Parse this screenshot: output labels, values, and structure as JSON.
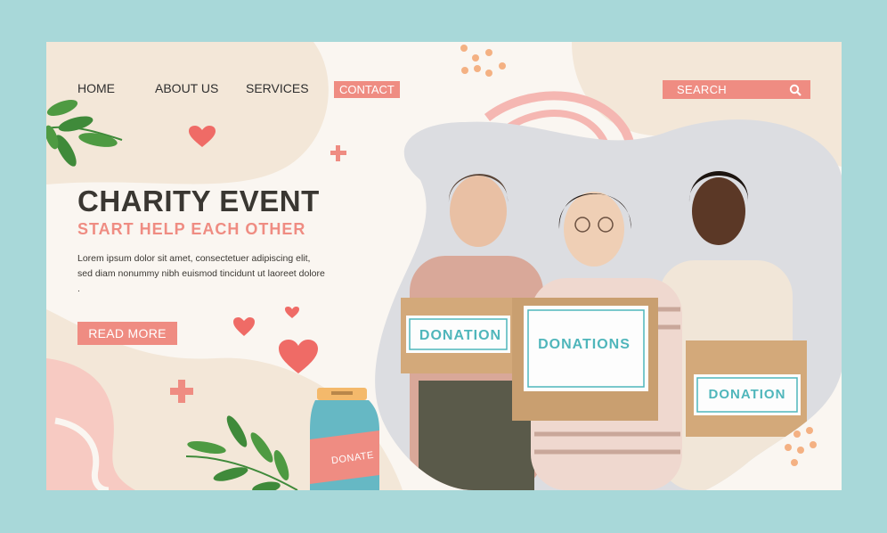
{
  "nav": {
    "home": "HOME",
    "about": "ABOUT US",
    "services": "SERVICES",
    "contact": "CONTACT"
  },
  "search": {
    "label": "SEARCH",
    "icon": "search-icon"
  },
  "hero": {
    "title": "CHARITY EVENT",
    "subtitle": "START HELP EACH OTHER",
    "body": "Lorem ipsum dolor sit amet, consectetuer adipiscing elit, sed diam nonummy nibh euismod tincidunt ut laoreet dolore .",
    "cta": "READ MORE"
  },
  "boxes": {
    "left": "DONATION",
    "center": "DONATIONS",
    "right": "DONATION"
  },
  "jar_label": "DONATE",
  "colors": {
    "accent": "#ef8c82",
    "frame": "#a8d8d9",
    "cream": "#f3e7d8",
    "teal": "#4fb6bb",
    "leaf": "#3f8a3a"
  }
}
